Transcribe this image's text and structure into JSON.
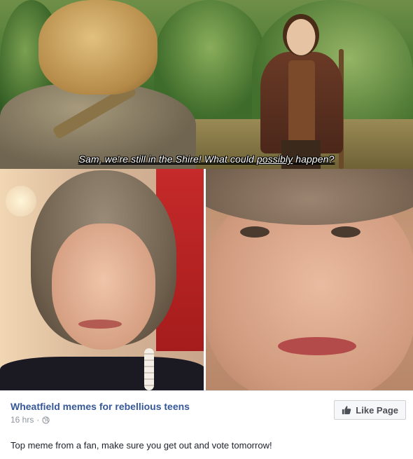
{
  "meme": {
    "subtitle_prefix": "Sam, we're still in the Shire! What could ",
    "subtitle_underlined": "possibly",
    "subtitle_suffix": " happen?"
  },
  "post": {
    "page_name": "Wheatfield memes for rebellious teens",
    "timestamp": "16 hrs",
    "separator": "·",
    "privacy_icon": "globe-icon",
    "like_button_label": "Like Page",
    "like_icon": "thumbs-up-icon",
    "caption": "Top meme from a fan, make sure you get out and vote tomorrow!"
  },
  "colors": {
    "link_blue": "#365899",
    "meta_gray": "#90949c",
    "button_bg": "#f6f7f9",
    "button_border": "#ced0d4"
  }
}
